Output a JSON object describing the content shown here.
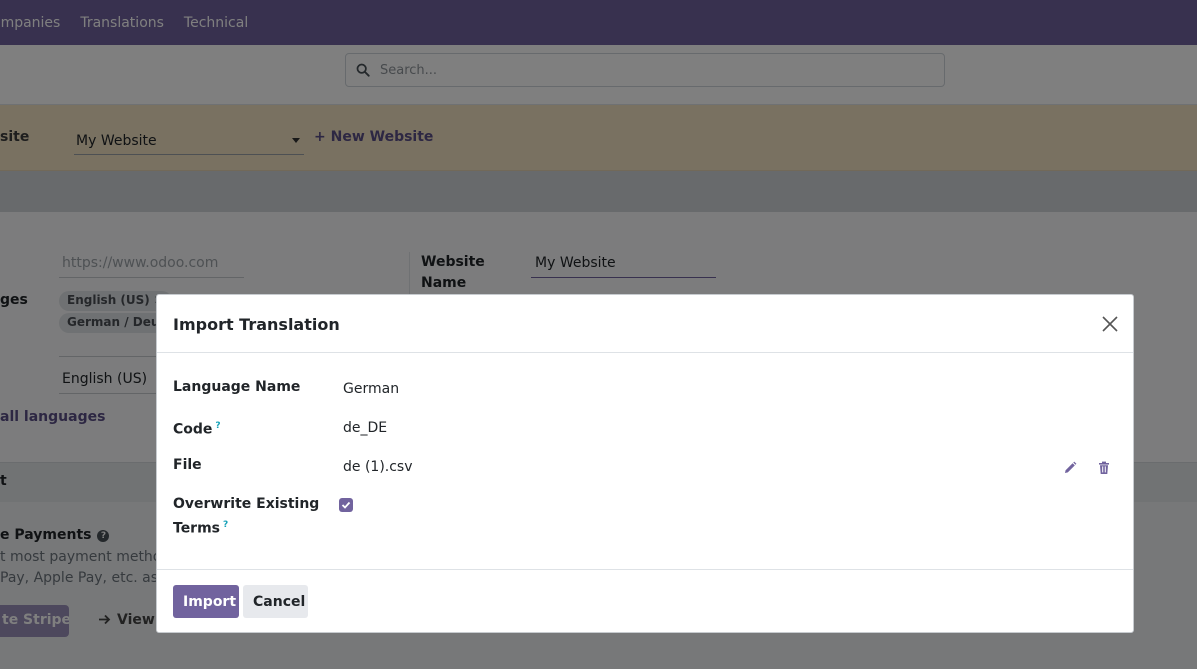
{
  "topnav": {
    "items": [
      "ompanies",
      "Translations",
      "Technical"
    ]
  },
  "search": {
    "placeholder": "Search..."
  },
  "website_bar": {
    "label": "site",
    "selected_website": "My Website",
    "new_website": "+ New Website"
  },
  "settings": {
    "domain_placeholder": "https://www.odoo.com",
    "website_name_label": "Website Name",
    "website_name_value": "My Website",
    "languages_label": "ges",
    "language_tags": [
      {
        "label": "English (US)",
        "remove": "✕"
      },
      {
        "label": "German / Deutsc"
      }
    ],
    "default_language": "English (US)",
    "install_languages": "all languages",
    "section_title": "t",
    "payments_title": "e Payments",
    "payments_desc_lines": [
      "t most payment methods",
      "Pay, Apple Pay, etc. as we"
    ],
    "stripe_button": "te Stripe",
    "view_link": "View A"
  },
  "modal": {
    "title": "Import Translation",
    "fields": {
      "language_name": {
        "label": "Language Name",
        "value": "German"
      },
      "code": {
        "label": "Code",
        "help": "?",
        "value": "de_DE"
      },
      "file": {
        "label": "File",
        "value": "de (1).csv"
      },
      "overwrite": {
        "label_line1": "Overwrite Existing",
        "label_line2": "Terms",
        "help": "?",
        "checked": true
      }
    },
    "buttons": {
      "import": "Import",
      "cancel": "Cancel"
    }
  },
  "colors": {
    "brand": "#71639e",
    "help_marker": "#17a2b8"
  }
}
